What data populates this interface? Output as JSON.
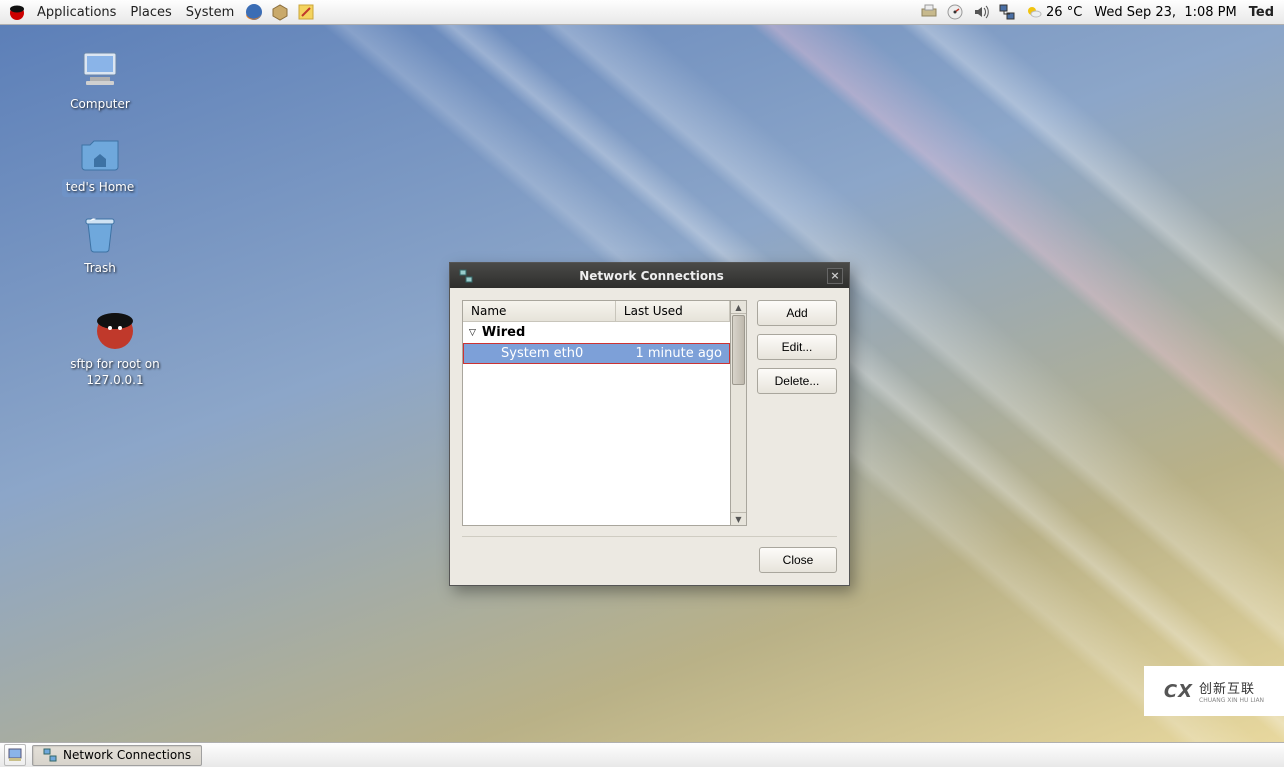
{
  "top_panel": {
    "menus": {
      "applications": "Applications",
      "places": "Places",
      "system": "System"
    },
    "weather": {
      "temp": "26 °C"
    },
    "clock": {
      "date": "Wed Sep 23,",
      "time": "1:08 PM"
    },
    "user": "Ted"
  },
  "desktop_icons": {
    "computer": "Computer",
    "home": "ted's Home",
    "trash": "Trash",
    "sftp": "sftp for root on 127.0.0.1"
  },
  "dialog": {
    "title": "Network Connections",
    "columns": {
      "name": "Name",
      "last_used": "Last Used"
    },
    "group": "Wired",
    "item": {
      "name": "System eth0",
      "last_used": "1 minute ago"
    },
    "buttons": {
      "add": "Add",
      "edit": "Edit...",
      "delete": "Delete...",
      "close": "Close"
    }
  },
  "bottom_panel": {
    "task": "Network Connections"
  },
  "watermark": {
    "brand": "创新互联",
    "sub": "CHUANG XIN HU LIAN"
  }
}
